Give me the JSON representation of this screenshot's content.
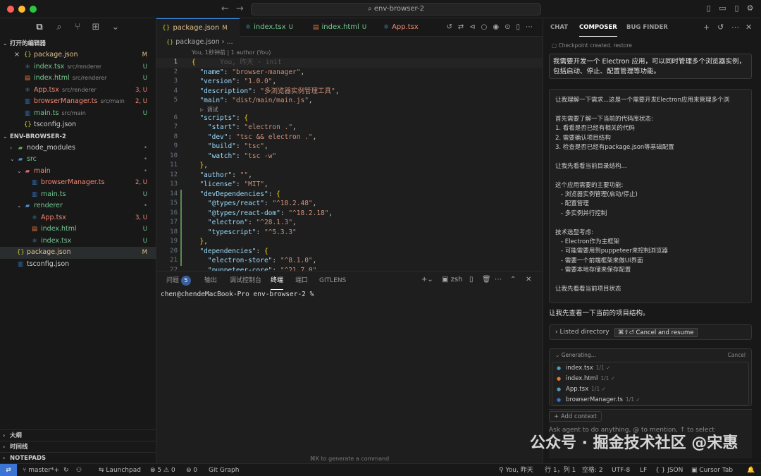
{
  "window": {
    "title": "env-browser-2"
  },
  "titlebar": {
    "search_icon": "search-icon"
  },
  "sidebar": {
    "open_editors_title": "打开的编辑器",
    "open_editors": [
      {
        "name": "package.json",
        "path": "",
        "status": "M",
        "icon": "json-icon",
        "close": "×"
      },
      {
        "name": "index.tsx",
        "path": "src/renderer",
        "status": "U",
        "icon": "react-icon"
      },
      {
        "name": "index.html",
        "path": "src/renderer",
        "status": "U",
        "icon": "html-icon"
      },
      {
        "name": "App.tsx",
        "path": "src/renderer",
        "status": "3, U",
        "icon": "react-icon"
      },
      {
        "name": "browserManager.ts",
        "path": "src/main",
        "status": "2, U",
        "icon": "ts-icon"
      },
      {
        "name": "main.ts",
        "path": "src/main",
        "status": "U",
        "icon": "ts-icon"
      },
      {
        "name": "tsconfig.json",
        "path": "",
        "status": "",
        "icon": "json-icon"
      }
    ],
    "workspace_title": "ENV-BROWSER-2",
    "tree": [
      {
        "name": "node_modules",
        "status": "•",
        "chev": "›"
      },
      {
        "name": "src",
        "status": "•",
        "chev": "⌄"
      },
      {
        "name": "main",
        "status": "•",
        "chev": "⌄"
      },
      {
        "name": "browserManager.ts",
        "status": "2, U"
      },
      {
        "name": "main.ts",
        "status": "U"
      },
      {
        "name": "renderer",
        "status": "•",
        "chev": "⌄"
      },
      {
        "name": "App.tsx",
        "status": "3, U"
      },
      {
        "name": "index.html",
        "status": "U"
      },
      {
        "name": "index.tsx",
        "status": "U"
      },
      {
        "name": "package.json",
        "status": "M"
      },
      {
        "name": "tsconfig.json",
        "status": ""
      }
    ],
    "bottom": [
      "大纲",
      "时间线",
      "NOTEPADS"
    ]
  },
  "editor": {
    "tabs": [
      {
        "name": "package.json",
        "status": "M"
      },
      {
        "name": "index.tsx",
        "status": "U"
      },
      {
        "name": "index.html",
        "status": "U"
      },
      {
        "name": "App.tsx",
        "status": ""
      }
    ],
    "breadcrumb": "package.json › ...",
    "blame": "You, 1秒钟前 | 1 author (You)",
    "ghost": "You, 昨天 · init",
    "codelens": "▷ 调试",
    "lines": [
      {
        "n": "1",
        "t": "{"
      },
      {
        "n": "2",
        "t": "  \"name\": \"browser-manager\","
      },
      {
        "n": "3",
        "t": "  \"version\": \"1.0.0\","
      },
      {
        "n": "4",
        "t": "  \"description\": \"多浏览器实例管理工具\","
      },
      {
        "n": "5",
        "t": "  \"main\": \"dist/main/main.js\","
      },
      {
        "n": "6",
        "t": "  \"scripts\": {"
      },
      {
        "n": "7",
        "t": "    \"start\": \"electron .\","
      },
      {
        "n": "8",
        "t": "    \"dev\": \"tsc && electron .\","
      },
      {
        "n": "9",
        "t": "    \"build\": \"tsc\","
      },
      {
        "n": "10",
        "t": "    \"watch\": \"tsc -w\""
      },
      {
        "n": "11",
        "t": "  },"
      },
      {
        "n": "12",
        "t": "  \"author\": \"\","
      },
      {
        "n": "13",
        "t": "  \"license\": \"MIT\","
      },
      {
        "n": "14",
        "t": "  \"devDependencies\": {"
      },
      {
        "n": "15",
        "t": "    \"@types/react\": \"^18.2.48\","
      },
      {
        "n": "16",
        "t": "    \"@types/react-dom\": \"^18.2.18\","
      },
      {
        "n": "17",
        "t": "    \"electron\": \"^28.1.3\","
      },
      {
        "n": "18",
        "t": "    \"typescript\": \"^5.3.3\""
      },
      {
        "n": "19",
        "t": "  },"
      },
      {
        "n": "20",
        "t": "  \"dependencies\": {"
      },
      {
        "n": "21",
        "t": "    \"electron-store\": \"^8.1.0\","
      },
      {
        "n": "22",
        "t": "    \"puppeteer-core\": \"^21.7.0\","
      }
    ]
  },
  "panel": {
    "tabs": [
      "问题",
      "输出",
      "调试控制台",
      "终端",
      "端口",
      "GITLENS"
    ],
    "problems_count": "5",
    "shell": "zsh",
    "terminal_line": "chen@chendeMacBook-Pro env-browser-2 %",
    "hint": "⌘K to generate a command"
  },
  "chat": {
    "tabs": [
      "CHAT",
      "COMPOSER",
      "BUG FINDER"
    ],
    "checkpoint": "Checkpoint created. restore",
    "user_message": "我需要开发一个 Electron 应用，可以同时管理多个浏览器实例，包括启动、停止、配置管理等功能。",
    "thinking": [
      "让我理解一下需求...这是一个需要开发Electron应用来管理多个浏",
      "",
      "首先需要了解一下当前的代码库状态:",
      "1. 看看是否已经有相关的代码",
      "2. 需要确认项目结构",
      "3. 检查是否已经有package.json等基础配置",
      "",
      "让我先看看当前目录结构...",
      "",
      "这个应用需要的主要功能:",
      "- 浏览器实例管理(启动/停止)",
      "- 配置管理",
      "- 多实例并行控制",
      "",
      "技术选型考虑:",
      "- Electron作为主框架",
      "- 可能需要用到puppeteer来控制浏览器",
      "- 需要一个前端框架来做UI界面",
      "- 需要本地存储来保存配置",
      "",
      "让我先看看当前项目状态"
    ],
    "after_thinking": "让我先查看一下当前的项目结构。",
    "listed": "Listed directory",
    "tooltip": "⌘⇧⏎ Cancel and resume",
    "generating": "Generating...",
    "cancel": "Cancel",
    "gen_files": [
      {
        "name": "index.tsx",
        "meta": "1/1 ✓"
      },
      {
        "name": "index.html",
        "meta": "1/1 ✓"
      },
      {
        "name": "App.tsx",
        "meta": "1/1 ✓"
      },
      {
        "name": "browserManager.ts",
        "meta": "1/1 ✓"
      }
    ],
    "add_context": "+ Add context",
    "input_placeholder": "Ask agent to do anything, @ to mention, ↑ to select"
  },
  "watermark": "公众号 · 掘金技术社区 @宋惠",
  "statusbar": {
    "branch": "master*+",
    "launchpad": "Launchpad",
    "errors": "5",
    "warnings": "0",
    "ports": "0",
    "gitgraph": "Git Graph",
    "blame": "You, 昨天",
    "position": "行 1，列 1",
    "spaces": "空格: 2",
    "encoding": "UTF-8",
    "eol": "LF",
    "lang": "{ } JSON",
    "cursor_tab": "Cursor Tab"
  },
  "colors": {
    "accent": "#3794ff",
    "modified": "#e2c08d",
    "untracked": "#73c991",
    "error": "#f48771"
  }
}
